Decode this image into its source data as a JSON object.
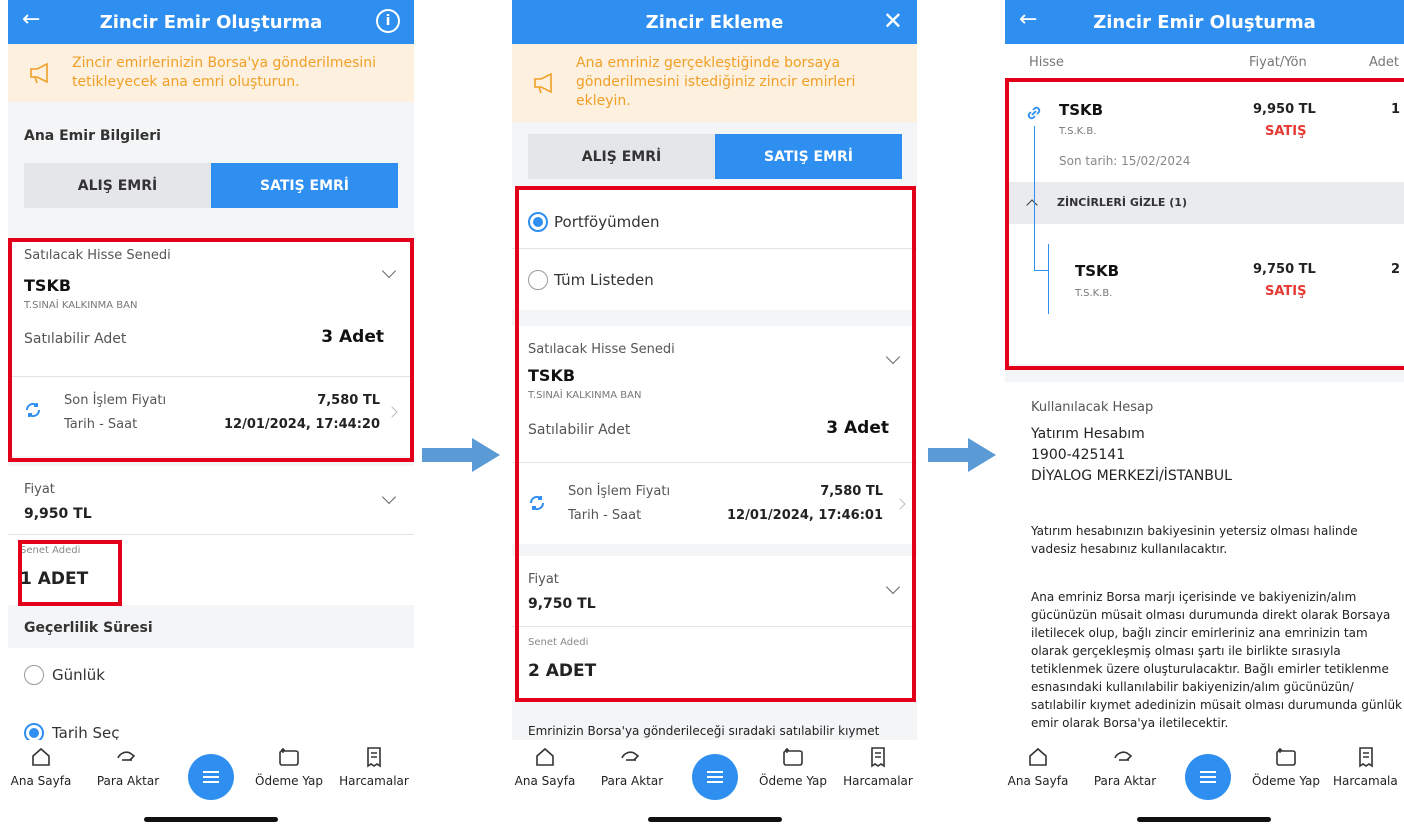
{
  "s1": {
    "title": "Zincir Emir Oluşturma",
    "banner": "Zincir emirlerinizin Borsa'ya gönderilmesini tetikleyecek ana emri oluşturun.",
    "section": "Ana Emir Bilgileri",
    "buy": "ALIŞ EMRİ",
    "sell": "SATIŞ EMRİ",
    "stock_label": "Satılacak Hisse Senedi",
    "stock_code": "TSKB",
    "stock_name": "T.SINAİ KALKINMA BAN",
    "sellable_label": "Satılabilir Adet",
    "sellable_value": "3 Adet",
    "last_price_label": "Son İşlem Fiyatı",
    "last_price_value": "7,580 TL",
    "datetime_label": "Tarih - Saat",
    "datetime_value": "12/01/2024, 17:44:20",
    "price_label": "Fiyat",
    "price_value": "9,950 TL",
    "qty_label": "Senet Adedi",
    "qty_value": "1 ADET",
    "validity_label": "Geçerlilik Süresi",
    "opt_daily": "Günlük",
    "opt_date": "Tarih Seç"
  },
  "s2": {
    "title": "Zincir Ekleme",
    "banner": "Ana emriniz gerçekleştiğinde borsaya gönderilmesini istediğiniz zincir emirleri ekleyin.",
    "buy": "ALIŞ EMRİ",
    "sell": "SATIŞ EMRİ",
    "opt_portfolio": "Portföyümden",
    "opt_all": "Tüm Listeden",
    "stock_label": "Satılacak Hisse Senedi",
    "stock_code": "TSKB",
    "stock_name": "T.SINAİ KALKINMA BAN",
    "sellable_label": "Satılabilir Adet",
    "sellable_value": "3 Adet",
    "last_price_label": "Son İşlem Fiyatı",
    "last_price_value": "7,580 TL",
    "datetime_label": "Tarih - Saat",
    "datetime_value": "12/01/2024, 17:46:01",
    "price_label": "Fiyat",
    "price_value": "9,750 TL",
    "qty_label": "Senet Adedi",
    "qty_value": "2 ADET",
    "footer_text": "Emrinizin Borsa'ya gönderileceği sıradaki satılabilir kıymet"
  },
  "s3": {
    "title": "Zincir Emir Oluşturma",
    "col_stock": "Hisse",
    "col_price": "Fiyat/Yön",
    "col_qty": "Adet",
    "main_code": "TSKB",
    "main_name": "T.S.K.B.",
    "main_price": "9,950 TL",
    "main_dir": "SATIŞ",
    "main_qty": "1",
    "main_deadline": "Son tarih: 15/02/2024",
    "hide_chains": "ZİNCİRLERİ GİZLE (1)",
    "chain_code": "TSKB",
    "chain_name": "T.S.K.B.",
    "chain_price": "9,750 TL",
    "chain_dir": "SATIŞ",
    "chain_qty": "2",
    "account_label": "Kullanılacak Hesap",
    "account_name": "Yatırım Hesabım",
    "account_no": "1900-425141",
    "account_branch": "DİYALOG MERKEZİ/İSTANBUL",
    "note1": "Yatırım hesabınızın bakiyesinin yetersiz olması halinde vadesiz hesabınız kullanılacaktır.",
    "note2": "Ana emriniz Borsa marjı içerisinde ve bakiyenizin/alım gücünüzün müsait olması durumunda direkt olarak Borsaya iletilecek olup, bağlı zincir emirleriniz ana emrinizin tam olarak gerçekleşmiş olması şartı ile birlikte sırasıyla tetiklenmek üzere oluşturulacaktır. Bağlı emirler tetiklenme esnasındaki kullanılabilir bakiyenizin/alım gücünüzün/ satılabilir kıymet adedinizin müsait olması durumunda günlük emir olarak Borsa'ya iletilecektir."
  },
  "nav": {
    "home": "Ana Sayfa",
    "transfer": "Para Aktar",
    "pay": "Ödeme Yap",
    "spend": "Harcamalar",
    "spend_cut": "Harcamala"
  },
  "colors": {
    "primary": "#2f8ff0",
    "highlight": "#e3001b",
    "sell": "#e53935",
    "banner_bg": "#fdf0de",
    "banner_text": "#f0a028",
    "arrow": "#5b9bd5"
  }
}
